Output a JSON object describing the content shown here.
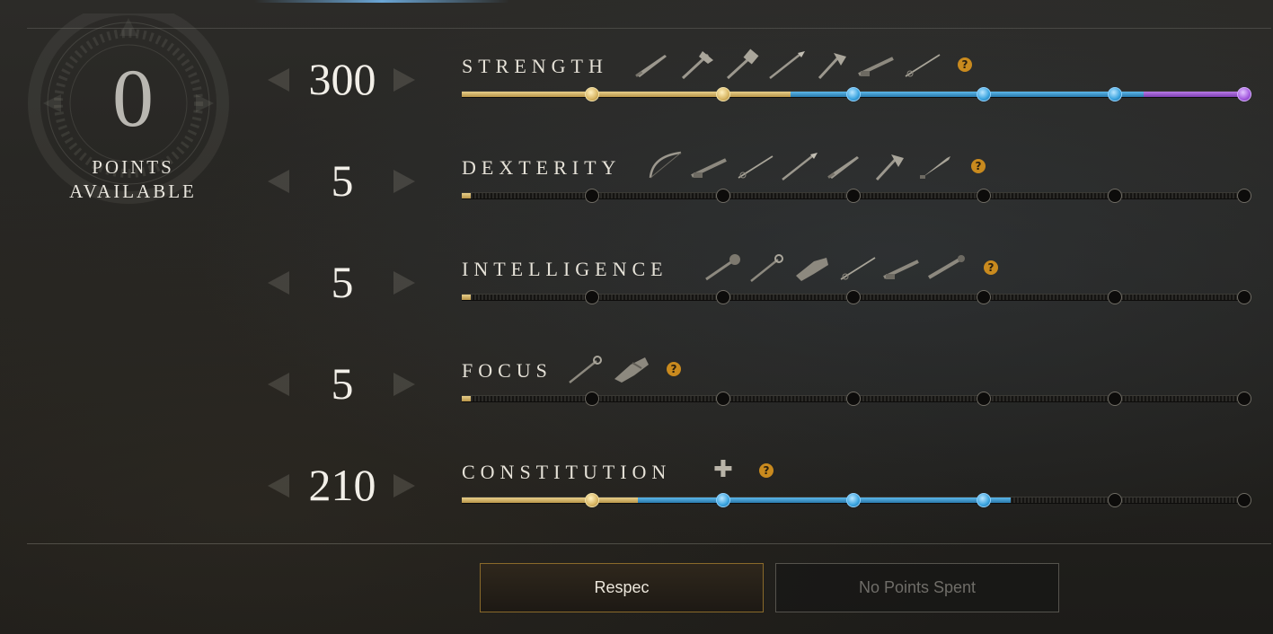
{
  "points": {
    "value": "0",
    "label_line1": "POINTS",
    "label_line2": "AVAILABLE"
  },
  "attributes": [
    {
      "name": "STRENGTH",
      "value": "300",
      "weapons": [
        "sword-icon",
        "war-hammer-axe-icon",
        "hammer-icon",
        "spear-icon",
        "hatchet-icon",
        "musket-icon",
        "rapier-icon"
      ],
      "segments": [
        {
          "color": "gold",
          "from": 0,
          "to": 0.42
        },
        {
          "color": "blue",
          "from": 0.42,
          "to": 0.87
        },
        {
          "color": "purple",
          "from": 0.87,
          "to": 1
        }
      ],
      "nodes": [
        "gold",
        "gold",
        "blue",
        "blue",
        "blue",
        "purple"
      ]
    },
    {
      "name": "DEXTERITY",
      "value": "5",
      "weapons": [
        "bow-icon",
        "musket-icon",
        "rapier-icon",
        "spear-icon",
        "sword-icon",
        "hatchet-icon",
        "dagger-icon"
      ],
      "segments": [
        {
          "color": "gold",
          "from": 0,
          "to": 0.012
        }
      ],
      "nodes": [
        "empty",
        "empty",
        "empty",
        "empty",
        "empty",
        "empty"
      ]
    },
    {
      "name": "INTELLIGENCE",
      "value": "5",
      "weapons": [
        "fire-staff-icon",
        "life-staff-icon",
        "ice-gauntlet-icon",
        "rapier-icon",
        "musket-icon",
        "blunderbuss-icon"
      ],
      "segments": [
        {
          "color": "gold",
          "from": 0,
          "to": 0.012
        }
      ],
      "nodes": [
        "empty",
        "empty",
        "empty",
        "empty",
        "empty",
        "empty"
      ]
    },
    {
      "name": "FOCUS",
      "value": "5",
      "weapons": [
        "life-staff-icon",
        "void-gauntlet-icon"
      ],
      "segments": [
        {
          "color": "gold",
          "from": 0,
          "to": 0.012
        }
      ],
      "nodes": [
        "empty",
        "empty",
        "empty",
        "empty",
        "empty",
        "empty"
      ]
    },
    {
      "name": "CONSTITUTION",
      "value": "210",
      "weapons": [],
      "segments": [
        {
          "color": "gold",
          "from": 0,
          "to": 0.225
        },
        {
          "color": "blue",
          "from": 0.225,
          "to": 0.701
        }
      ],
      "nodes": [
        "gold",
        "blue",
        "blue",
        "blue",
        "empty",
        "empty"
      ]
    }
  ],
  "help_symbol": "?",
  "plus_symbol": "✚",
  "buttons": {
    "respec": "Respec",
    "no_points": "No Points Spent"
  },
  "colors": {
    "gold": "#d8b664",
    "blue": "#3aa4e0",
    "purple": "#a45ae0",
    "help": "#c98a1e"
  }
}
